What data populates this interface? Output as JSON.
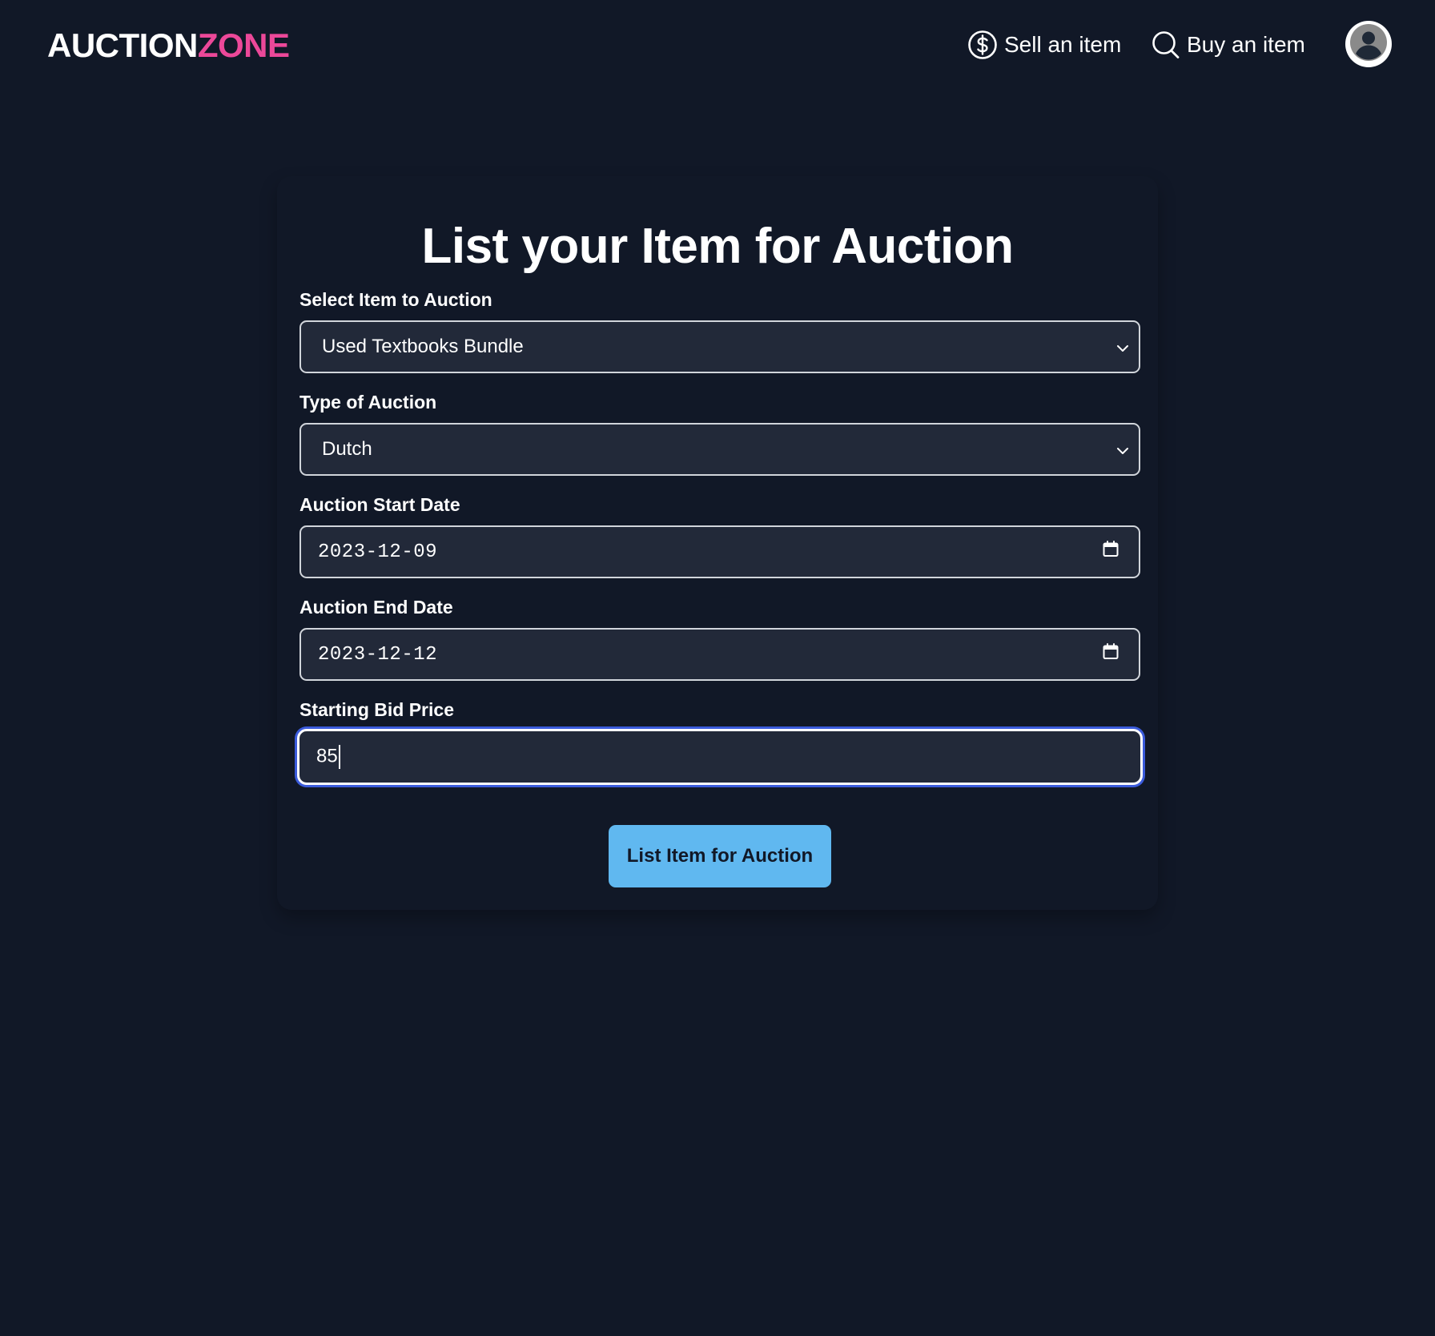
{
  "header": {
    "logo_part1": "AUCTION",
    "logo_part2": "ZONE",
    "nav": {
      "sell_label": "Sell an item",
      "sell_icon": "dollar-circle-icon",
      "buy_label": "Buy an item",
      "buy_icon": "search-icon"
    },
    "avatar_icon": "user-avatar-icon"
  },
  "form": {
    "title": "List your Item for Auction",
    "item": {
      "label": "Select Item to Auction",
      "selected": "Used Textbooks Bundle",
      "icon": "chevron-down-icon"
    },
    "auction_type": {
      "label": "Type of Auction",
      "selected": "Dutch",
      "icon": "chevron-down-icon"
    },
    "start_date": {
      "label": "Auction Start Date",
      "value": "2023-12-09",
      "icon": "calendar-icon"
    },
    "end_date": {
      "label": "Auction End Date",
      "value": "2023-12-12",
      "icon": "calendar-icon"
    },
    "starting_bid": {
      "label": "Starting Bid Price",
      "value": "85"
    },
    "submit_label": "List Item for Auction"
  },
  "colors": {
    "background": "#111827",
    "field_background": "#222939",
    "logo_accent": "#ec4899",
    "button": "#60b8f0",
    "focus_ring": "#3b5bdb"
  }
}
